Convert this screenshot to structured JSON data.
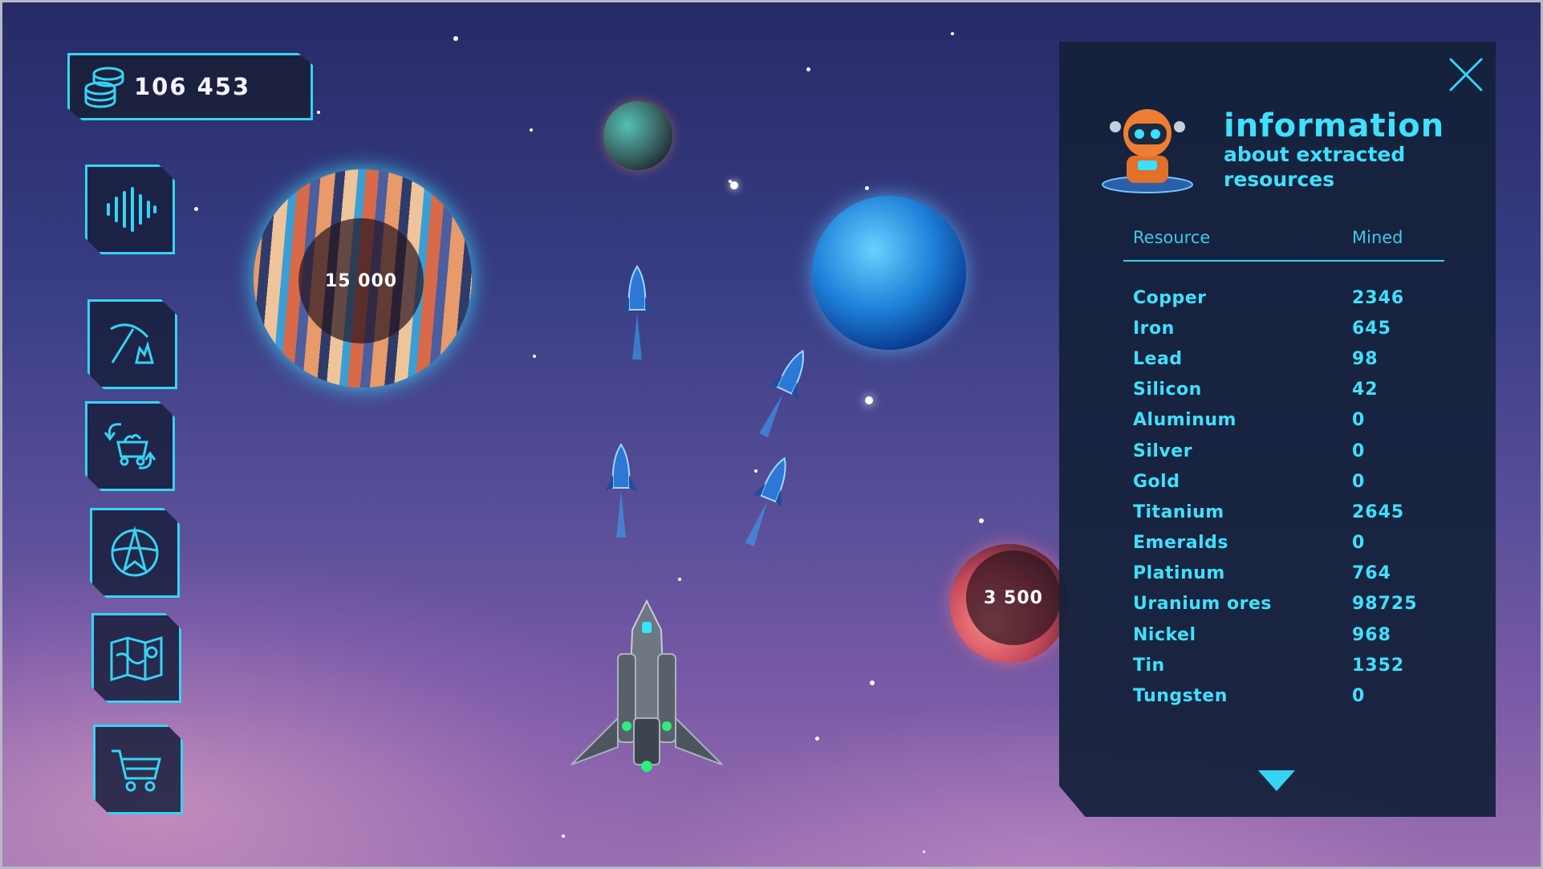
{
  "wallet": {
    "icon": "coin-stack-icon",
    "amount": "106 453"
  },
  "side_menu": [
    {
      "id": "sound",
      "icon": "sound-wave-icon"
    },
    {
      "id": "mining",
      "icon": "pickaxe-crystal-icon"
    },
    {
      "id": "trade",
      "icon": "mine-cart-exchange-icon"
    },
    {
      "id": "galaxy",
      "icon": "globe-compass-icon"
    },
    {
      "id": "map",
      "icon": "map-icon"
    },
    {
      "id": "shop",
      "icon": "shopping-cart-icon"
    }
  ],
  "planets": [
    {
      "id": "marble-planet",
      "label": "15 000"
    },
    {
      "id": "red-planet",
      "label": "3 500"
    }
  ],
  "info_panel": {
    "title": "information",
    "subtitle_line1": "about extracted",
    "subtitle_line2": "resources",
    "col_resource": "Resource",
    "col_mined": "Mined",
    "rows": [
      {
        "name": "Copper",
        "value": "2346"
      },
      {
        "name": "Iron",
        "value": "645"
      },
      {
        "name": "Lead",
        "value": "98"
      },
      {
        "name": "Silicon",
        "value": "42"
      },
      {
        "name": "Aluminum",
        "value": "0"
      },
      {
        "name": "Silver",
        "value": "0"
      },
      {
        "name": "Gold",
        "value": "0"
      },
      {
        "name": "Titanium",
        "value": "2645"
      },
      {
        "name": "Emeralds",
        "value": "0"
      },
      {
        "name": "Platinum",
        "value": "764"
      },
      {
        "name": "Uranium ores",
        "value": "98725"
      },
      {
        "name": "Nickel",
        "value": "968"
      },
      {
        "name": "Tin",
        "value": "1352"
      },
      {
        "name": "Tungsten",
        "value": "0"
      }
    ]
  },
  "colors": {
    "accent": "#35d4f3",
    "panel": "#14213a"
  }
}
